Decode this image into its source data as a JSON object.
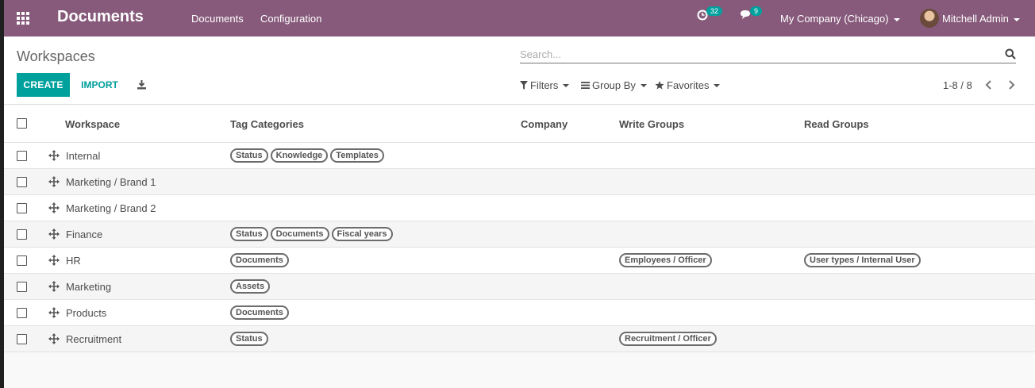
{
  "navbar": {
    "brand": "Documents",
    "menu": [
      "Documents",
      "Configuration"
    ],
    "activity_count": "32",
    "message_count": "9",
    "company": "My Company (Chicago)",
    "user": "Mitchell Admin",
    "color": "#875a7b"
  },
  "control_panel": {
    "breadcrumb": "Workspaces",
    "search_placeholder": "Search...",
    "create_label": "CREATE",
    "import_label": "IMPORT",
    "filters_label": "Filters",
    "groupby_label": "Group By",
    "favorites_label": "Favorites",
    "pager": "1-8 / 8",
    "accent": "#00a09d"
  },
  "table": {
    "columns": [
      "Workspace",
      "Tag Categories",
      "Company",
      "Write Groups",
      "Read Groups"
    ],
    "rows": [
      {
        "workspace": "Internal",
        "tags": [
          "Status",
          "Knowledge",
          "Templates"
        ],
        "company": "",
        "write": [],
        "read": []
      },
      {
        "workspace": "Marketing / Brand 1",
        "tags": [],
        "company": "",
        "write": [],
        "read": []
      },
      {
        "workspace": "Marketing / Brand 2",
        "tags": [],
        "company": "",
        "write": [],
        "read": []
      },
      {
        "workspace": "Finance",
        "tags": [
          "Status",
          "Documents",
          "Fiscal years"
        ],
        "company": "",
        "write": [],
        "read": []
      },
      {
        "workspace": "HR",
        "tags": [
          "Documents"
        ],
        "company": "",
        "write": [
          "Employees / Officer"
        ],
        "read": [
          "User types / Internal User"
        ]
      },
      {
        "workspace": "Marketing",
        "tags": [
          "Assets"
        ],
        "company": "",
        "write": [],
        "read": []
      },
      {
        "workspace": "Products",
        "tags": [
          "Documents"
        ],
        "company": "",
        "write": [],
        "read": []
      },
      {
        "workspace": "Recruitment",
        "tags": [
          "Status"
        ],
        "company": "",
        "write": [
          "Recruitment / Officer"
        ],
        "read": []
      }
    ]
  }
}
